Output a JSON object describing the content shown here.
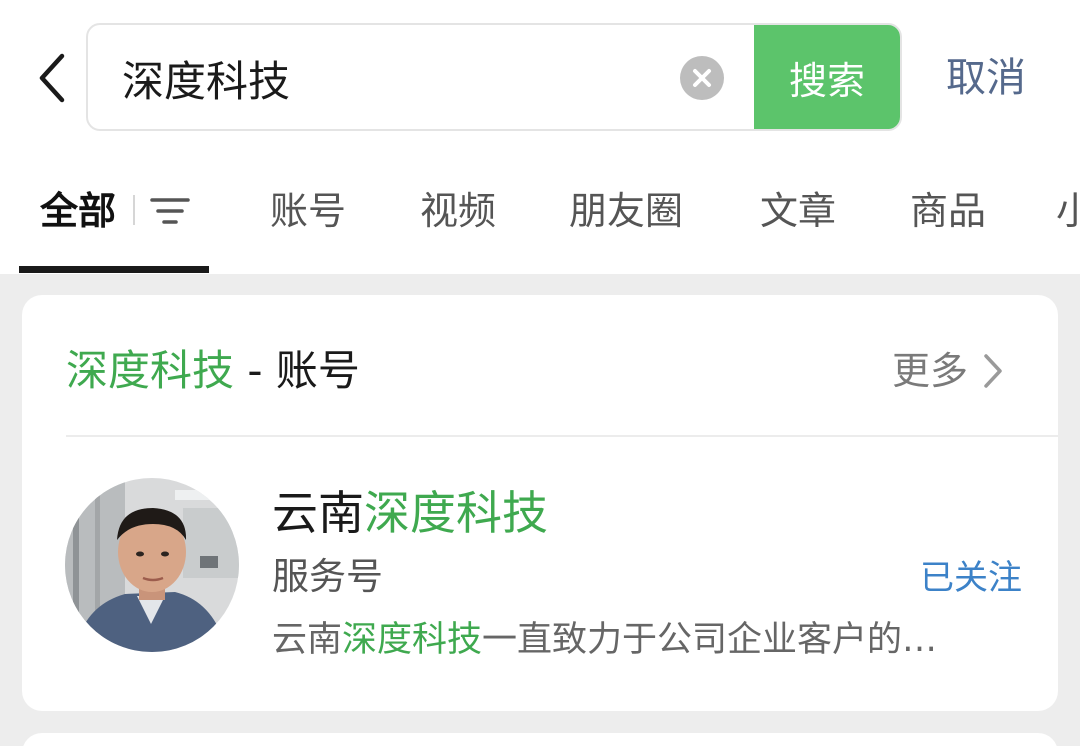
{
  "search": {
    "query": "深度科技",
    "button_label": "搜索",
    "cancel_label": "取消"
  },
  "tabs": [
    {
      "label": "全部",
      "active": true
    },
    {
      "label": "账号"
    },
    {
      "label": "视频"
    },
    {
      "label": "朋友圈"
    },
    {
      "label": "文章"
    },
    {
      "label": "商品"
    },
    {
      "label": "小"
    }
  ],
  "account_section": {
    "keyword": "深度科技",
    "suffix": " - 账号",
    "more_label": "更多",
    "result": {
      "name_prefix": "云南",
      "name_highlight": "深度科技",
      "type": "服务号",
      "follow_status": "已关注",
      "desc_prefix": "云南",
      "desc_highlight": "深度科技",
      "desc_rest": "一直致力于公司企业客户的…"
    }
  },
  "colors": {
    "accent_green": "#5cc46b",
    "highlight_green": "#3fa94f",
    "link_blue": "#3c82c8",
    "cancel_blue": "#55698c"
  },
  "icons": [
    "back-arrow-icon",
    "clear-icon",
    "filter-icon",
    "chevron-right-icon",
    "avatar-photo"
  ]
}
